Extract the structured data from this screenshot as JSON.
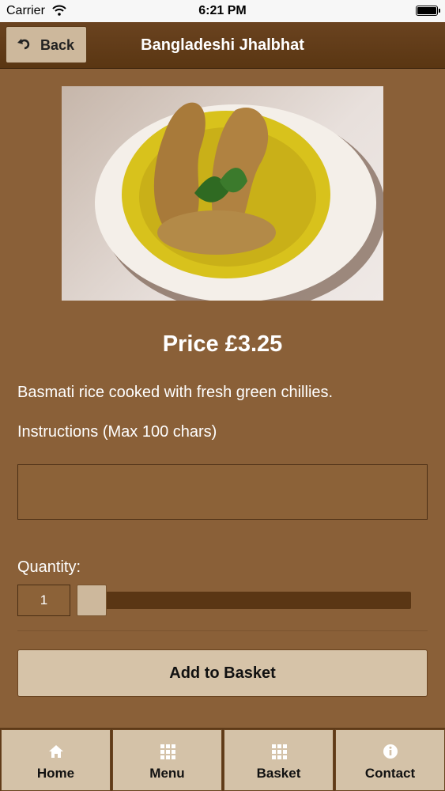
{
  "status_bar": {
    "carrier": "Carrier",
    "time": "6:21 PM"
  },
  "header": {
    "back_label": "Back",
    "title": "Bangladeshi Jhalbhat"
  },
  "dish": {
    "price": "Price £3.25",
    "description": "Basmati rice cooked with fresh green chillies.",
    "instructions_label": "Instructions (Max 100 chars)",
    "instructions_value": "",
    "quantity_label": "Quantity:",
    "quantity_value": "1",
    "quantity_slider_fraction": 0.0
  },
  "add_button_label": "Add to Basket",
  "tabs": [
    {
      "label": "Home",
      "icon": "home-icon"
    },
    {
      "label": "Menu",
      "icon": "grid-icon"
    },
    {
      "label": "Basket",
      "icon": "grid-icon"
    },
    {
      "label": "Contact",
      "icon": "info-icon"
    }
  ],
  "colors": {
    "background": "#8a6038",
    "header": "#5a3612",
    "button": "#d6c3a8",
    "text": "#ffffff"
  }
}
